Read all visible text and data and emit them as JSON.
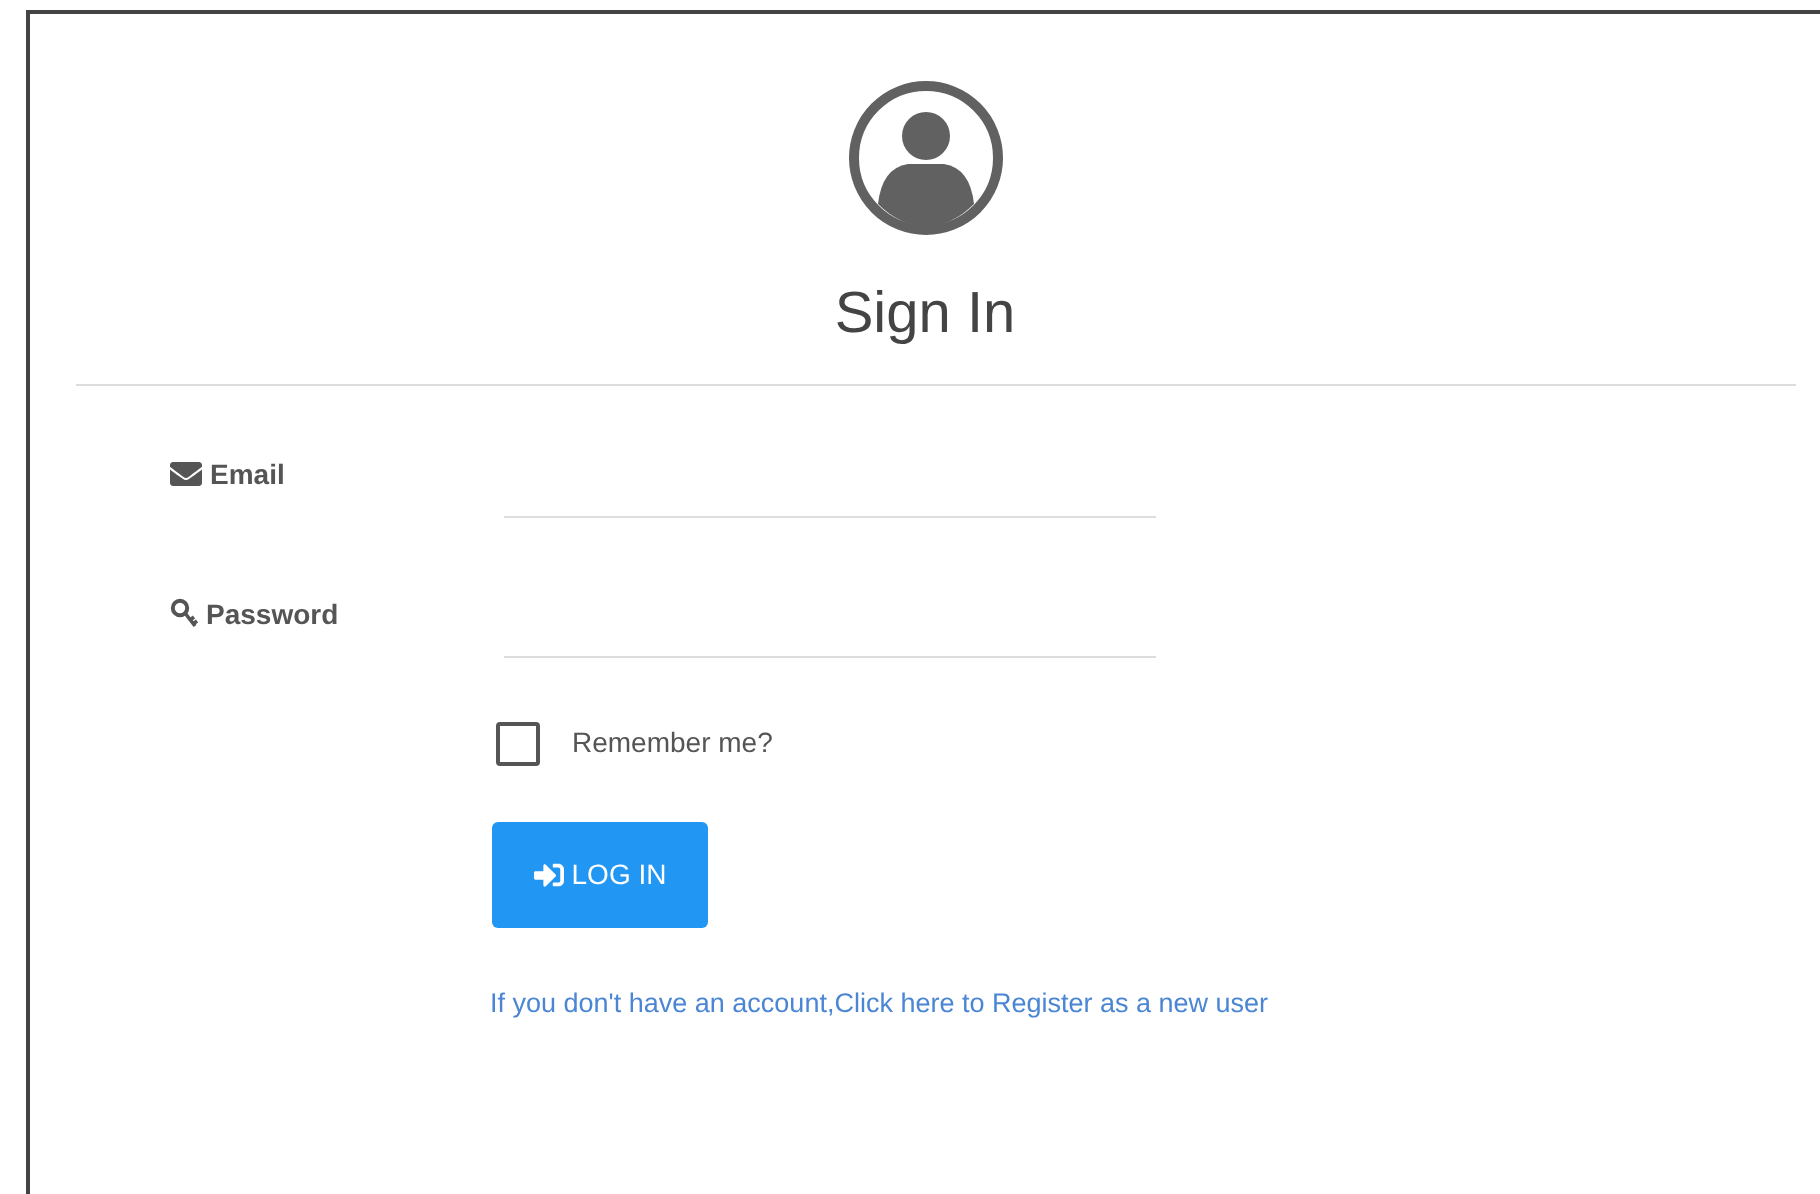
{
  "title": "Sign In",
  "fields": [
    {
      "kind": "email",
      "label": "Email"
    },
    {
      "kind": "password",
      "label": "Password"
    }
  ],
  "remember": {
    "label": "Remember me?",
    "checked": false
  },
  "login_button": "LOG IN",
  "register_link": "If you don't have an account,Click here to Register as a new user"
}
